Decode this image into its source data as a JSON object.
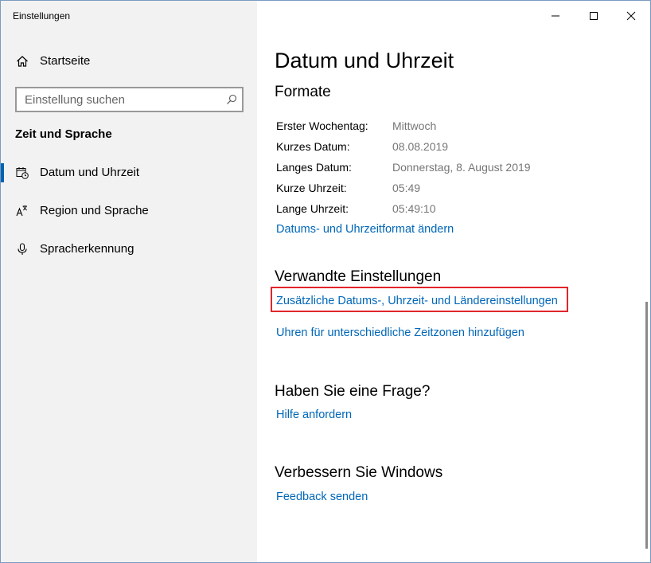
{
  "window": {
    "title": "Einstellungen",
    "controls": {
      "minimize_icon": "minimize-icon",
      "maximize_icon": "maximize-icon",
      "close_icon": "close-icon"
    }
  },
  "sidebar": {
    "home": {
      "label": "Startseite",
      "icon": "home-icon"
    },
    "search": {
      "placeholder": "Einstellung suchen",
      "value": "",
      "icon": "search-icon"
    },
    "section_title": "Zeit und Sprache",
    "items": [
      {
        "label": "Datum und Uhrzeit",
        "icon": "calendar-clock-icon",
        "selected": true
      },
      {
        "label": "Region und Sprache",
        "icon": "language-icon",
        "selected": false
      },
      {
        "label": "Spracherkennung",
        "icon": "microphone-icon",
        "selected": false
      }
    ]
  },
  "main": {
    "title": "Datum und Uhrzeit",
    "formats": {
      "heading": "Formate",
      "rows": [
        {
          "label": "Erster Wochentag:",
          "value": "Mittwoch"
        },
        {
          "label": "Kurzes Datum:",
          "value": "08.08.2019"
        },
        {
          "label": "Langes Datum:",
          "value": "Donnerstag, 8. August 2019"
        },
        {
          "label": "Kurze Uhrzeit:",
          "value": "05:49"
        },
        {
          "label": "Lange Uhrzeit:",
          "value": "05:49:10"
        }
      ],
      "change_link": "Datums- und Uhrzeitformat ändern"
    },
    "related": {
      "heading": "Verwandte Einstellungen",
      "links": [
        "Zusätzliche Datums-, Uhrzeit- und Ländereinstellungen",
        "Uhren für unterschiedliche Zeitzonen hinzufügen"
      ]
    },
    "question": {
      "heading": "Haben Sie eine Frage?",
      "link": "Hilfe anfordern"
    },
    "improve": {
      "heading": "Verbessern Sie Windows",
      "link": "Feedback senden"
    }
  },
  "colors": {
    "accent": "#0067b8",
    "selection_bar": "#0063b1",
    "highlight_box": "#e0262b",
    "sidebar_bg": "#f2f2f2",
    "muted_text": "#767676"
  }
}
